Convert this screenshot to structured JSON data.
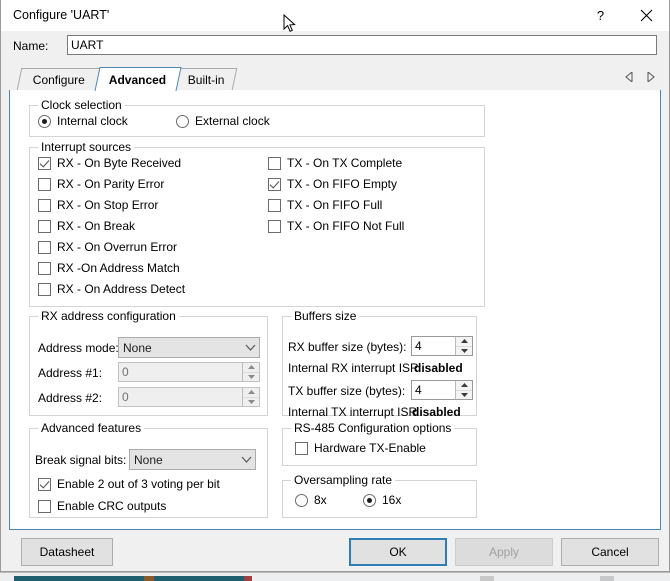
{
  "window": {
    "title": "Configure 'UART'",
    "help_icon": "question-mark-icon",
    "close_icon": "close-icon"
  },
  "name_field": {
    "label": "Name:",
    "value": "UART",
    "placeholder": ""
  },
  "tabs": {
    "items": [
      {
        "label": "Configure",
        "selected": false
      },
      {
        "label": "Advanced",
        "selected": true
      },
      {
        "label": "Built-in",
        "selected": false
      }
    ],
    "nav_prev_icon": "triangle-left-icon",
    "nav_next_icon": "triangle-right-icon"
  },
  "clock_selection": {
    "legend": "Clock selection",
    "options": [
      {
        "label": "Internal clock",
        "selected": true
      },
      {
        "label": "External clock",
        "selected": false
      }
    ]
  },
  "interrupt_sources": {
    "legend": "Interrupt sources",
    "rx": [
      {
        "label": "RX - On Byte Received",
        "checked": true
      },
      {
        "label": "RX - On Parity Error",
        "checked": false
      },
      {
        "label": "RX - On Stop Error",
        "checked": false
      },
      {
        "label": "RX - On Break",
        "checked": false
      },
      {
        "label": "RX - On Overrun Error",
        "checked": false
      },
      {
        "label": "RX -On Address Match",
        "checked": false
      },
      {
        "label": "RX - On Address Detect",
        "checked": false
      }
    ],
    "tx": [
      {
        "label": "TX - On TX Complete",
        "checked": false
      },
      {
        "label": "TX - On FIFO Empty",
        "checked": true
      },
      {
        "label": "TX - On FIFO Full",
        "checked": false
      },
      {
        "label": "TX - On FIFO Not Full",
        "checked": false
      }
    ]
  },
  "rx_address_configuration": {
    "legend": "RX address configuration",
    "address_mode": {
      "label": "Address mode:",
      "value": "None",
      "chevron_icon": "chevron-down-icon"
    },
    "address_1": {
      "label": "Address #1:",
      "value": "0",
      "disabled": true
    },
    "address_2": {
      "label": "Address #2:",
      "value": "0",
      "disabled": true
    }
  },
  "buffers_size": {
    "legend": "Buffers size",
    "rx_buffer": {
      "label": "RX buffer size (bytes):",
      "value": "4"
    },
    "rx_isr": {
      "label": "Internal RX interrupt ISR is",
      "status": "disabled"
    },
    "tx_buffer": {
      "label": "TX buffer size (bytes):",
      "value": "4"
    },
    "tx_isr": {
      "label": "Internal TX interrupt ISR is",
      "status": "disabled"
    }
  },
  "advanced_features": {
    "legend": "Advanced features",
    "break_signal_bits": {
      "label": "Break signal bits:",
      "value": "None",
      "chevron_icon": "chevron-down-icon"
    },
    "checks": [
      {
        "label": "Enable 2 out of 3 voting per bit",
        "checked": true
      },
      {
        "label": "Enable CRC outputs",
        "checked": false
      }
    ]
  },
  "rs485_options": {
    "legend": "RS-485 Configuration options",
    "hardware_tx_enable": {
      "label": "Hardware TX-Enable",
      "checked": false
    }
  },
  "oversampling_rate": {
    "legend": "Oversampling rate",
    "options": [
      {
        "label": "8x",
        "selected": false
      },
      {
        "label": "16x",
        "selected": true
      }
    ]
  },
  "buttons": {
    "datasheet": "Datasheet",
    "ok": "OK",
    "apply": "Apply",
    "cancel": "Cancel"
  },
  "colors": {
    "accent": "#2e7eb3",
    "tab_underline": "#4a86b5",
    "dialog_bg": "#f0f0f0",
    "page_bg": "#ffffff"
  }
}
